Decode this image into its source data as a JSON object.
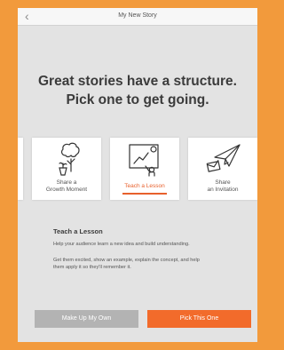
{
  "header": {
    "title": "My New Story",
    "back_icon": "chevron-left-icon"
  },
  "headline": {
    "line1": "Great stories have a structure.",
    "line2": "Pick one to get going."
  },
  "cards": [
    {
      "label_line1": "Share a",
      "label_line2": "Growth Moment",
      "icon": "tree-plant-icon",
      "selected": false
    },
    {
      "label_line1": "Teach a Lesson",
      "label_line2": "",
      "icon": "presentation-board-icon",
      "selected": true
    },
    {
      "label_line1": "Share",
      "label_line2": "an Invitation",
      "icon": "paper-plane-envelope-icon",
      "selected": false
    }
  ],
  "description": {
    "title": "Teach a Lesson",
    "paragraph1": "Help your audience learn a new idea and build understanding.",
    "paragraph2_line1": "Get them excited, show an example, explain the concept, and help",
    "paragraph2_line2": "them apply it so they'll remember it."
  },
  "buttons": {
    "secondary": "Make Up My Own",
    "primary": "Pick This One"
  },
  "colors": {
    "accent": "#f26b2b",
    "frame": "#f29a3c",
    "background": "#e3e3e3",
    "disabled_button": "#b3b3b3"
  }
}
